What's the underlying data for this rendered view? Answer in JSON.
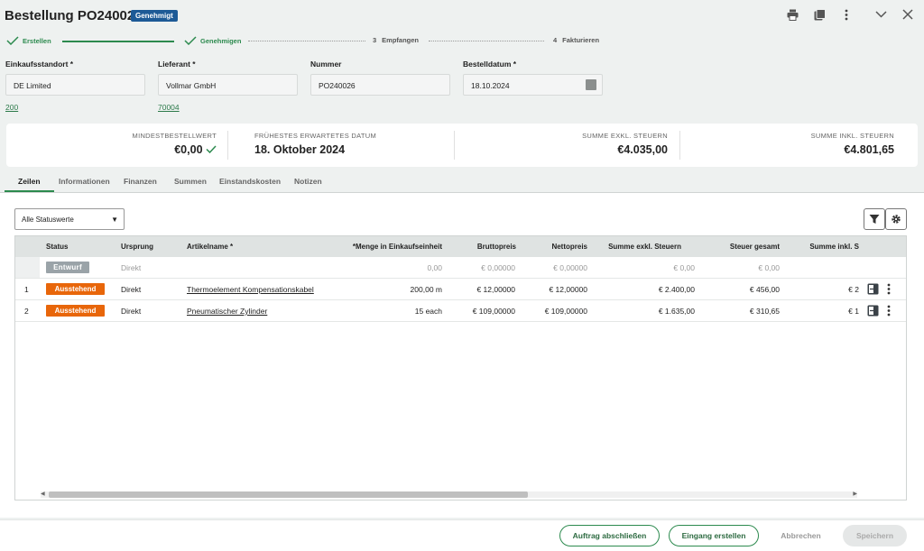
{
  "header": {
    "title": "Bestellung PO240026",
    "status_badge": "Genehmigt",
    "icons": [
      "print-icon",
      "copy-icon",
      "more-vert-icon",
      "chevron-down-icon",
      "close-icon"
    ]
  },
  "steps": [
    {
      "num": "",
      "label": "Erstellen",
      "state": "done"
    },
    {
      "num": "",
      "label": "Genehmigen",
      "state": "done"
    },
    {
      "num": "3",
      "label": "Empfangen",
      "state": "pending"
    },
    {
      "num": "4",
      "label": "Fakturieren",
      "state": "pending"
    }
  ],
  "fields": {
    "site": {
      "label": "Einkaufsstandort *",
      "value": "DE Limited",
      "link": "200"
    },
    "vendor": {
      "label": "Lieferant *",
      "value": "Vollmar GmbH",
      "link": "70004"
    },
    "number": {
      "label": "Nummer",
      "value": "PO240026"
    },
    "date": {
      "label": "Bestelldatum *",
      "value": "18.10.2024"
    }
  },
  "summary": {
    "min_label": "MINDESTBESTELLWERT",
    "min_value": "€0,00",
    "earliest_label": "FRÜHESTES ERWARTETES DATUM",
    "earliest_value": "18. Oktober 2024",
    "excl_label": "SUMME EXKL. STEUERN",
    "excl_value": "€4.035,00",
    "incl_label": "SUMME INKL. STEUERN",
    "incl_value": "€4.801,65"
  },
  "tabs": [
    "Zeilen",
    "Informationen",
    "Finanzen",
    "Summen",
    "Einstandskosten",
    "Notizen"
  ],
  "filter": {
    "status_select": "Alle Statuswerte"
  },
  "table": {
    "headers": [
      "Status",
      "Ursprung",
      "Artikelname *",
      "*Menge in Einkaufseinheit",
      "Bruttopreis",
      "Nettopreis",
      "Summe exkl. Steuern",
      "Steuer gesamt",
      "Summe inkl. S"
    ],
    "draft_row": {
      "status": "Entwurf",
      "origin": "Direkt",
      "qty": "0,00",
      "gross": "€ 0,00000",
      "net": "€ 0,00000",
      "excl": "€ 0,00",
      "tax": "€ 0,00"
    },
    "rows": [
      {
        "num": "1",
        "status": "Ausstehend",
        "origin": "Direkt",
        "item": "Thermoelement Kompensationskabel",
        "qty": "200,00 m",
        "gross": "€ 12,00000",
        "net": "€ 12,00000",
        "excl": "€ 2.400,00",
        "tax": "€ 456,00",
        "incl": "€ 2"
      },
      {
        "num": "2",
        "status": "Ausstehend",
        "origin": "Direkt",
        "item": "Pneumatischer Zylinder",
        "qty": "15 each",
        "gross": "€ 109,00000",
        "net": "€ 109,00000",
        "excl": "€ 1.635,00",
        "tax": "€ 310,65",
        "incl": "€ 1"
      }
    ]
  },
  "footer": {
    "complete": "Auftrag abschließen",
    "receipt": "Eingang erstellen",
    "cancel": "Abbrechen",
    "save": "Speichern"
  },
  "colors": {
    "accent": "#2c8a4e",
    "badge": "#1d5a96",
    "pending": "#e8660a",
    "draft": "#9aa3a8"
  }
}
